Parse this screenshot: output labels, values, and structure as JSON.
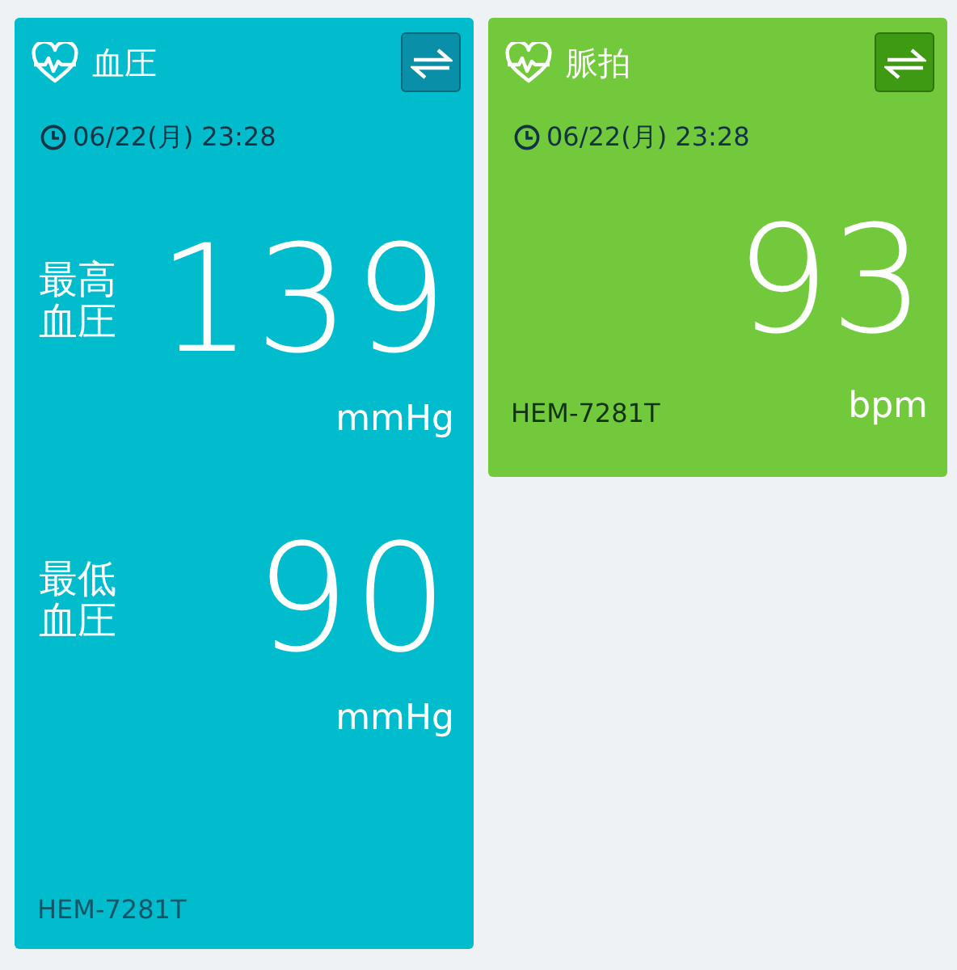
{
  "cards": [
    {
      "kind": "blood_pressure",
      "title": "血圧",
      "color": "#00bccd",
      "time": "06/22(月) 23:28",
      "readings": [
        {
          "label": "最高血圧",
          "value": "139",
          "unit": "mmHg"
        },
        {
          "label": "最低血圧",
          "value": "90",
          "unit": "mmHg"
        }
      ],
      "device": "HEM-7281T"
    },
    {
      "kind": "pulse",
      "title": "脈拍",
      "color": "#72c93c",
      "time": "06/22(月) 23:28",
      "readings": [
        {
          "value": "93",
          "unit": "bpm"
        }
      ],
      "device": "HEM-7281T"
    }
  ]
}
